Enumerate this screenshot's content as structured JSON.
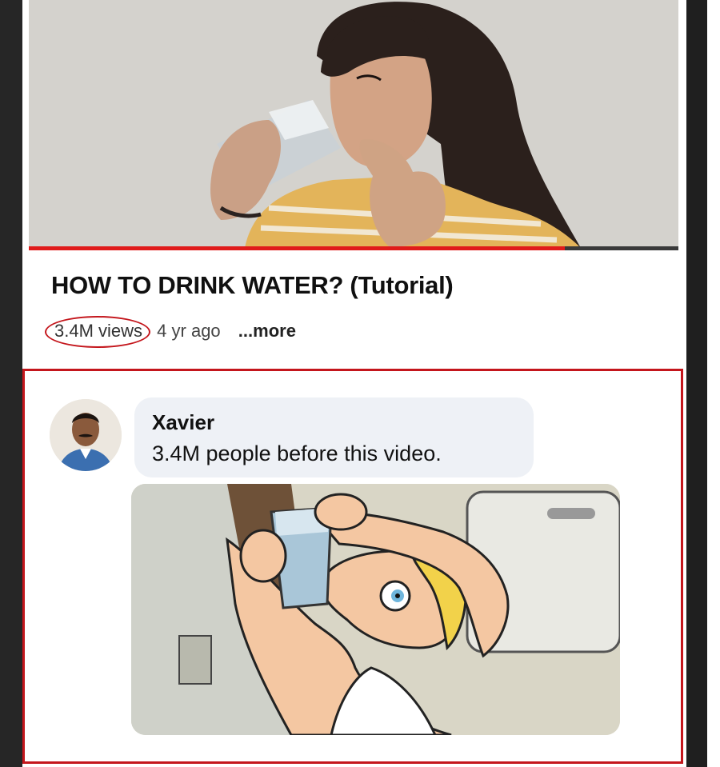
{
  "video": {
    "title": "HOW TO DRINK WATER? (Tutorial)",
    "views": "3.4M views",
    "age": "4 yr ago",
    "more_label": "...more",
    "progress": 0.825
  },
  "comment": {
    "author": "Xavier",
    "text": "3.4M people before this video."
  },
  "colors": {
    "accent_red": "#c4161c",
    "progress_red": "#e01b1b",
    "bubble_bg": "#eef1f6"
  }
}
